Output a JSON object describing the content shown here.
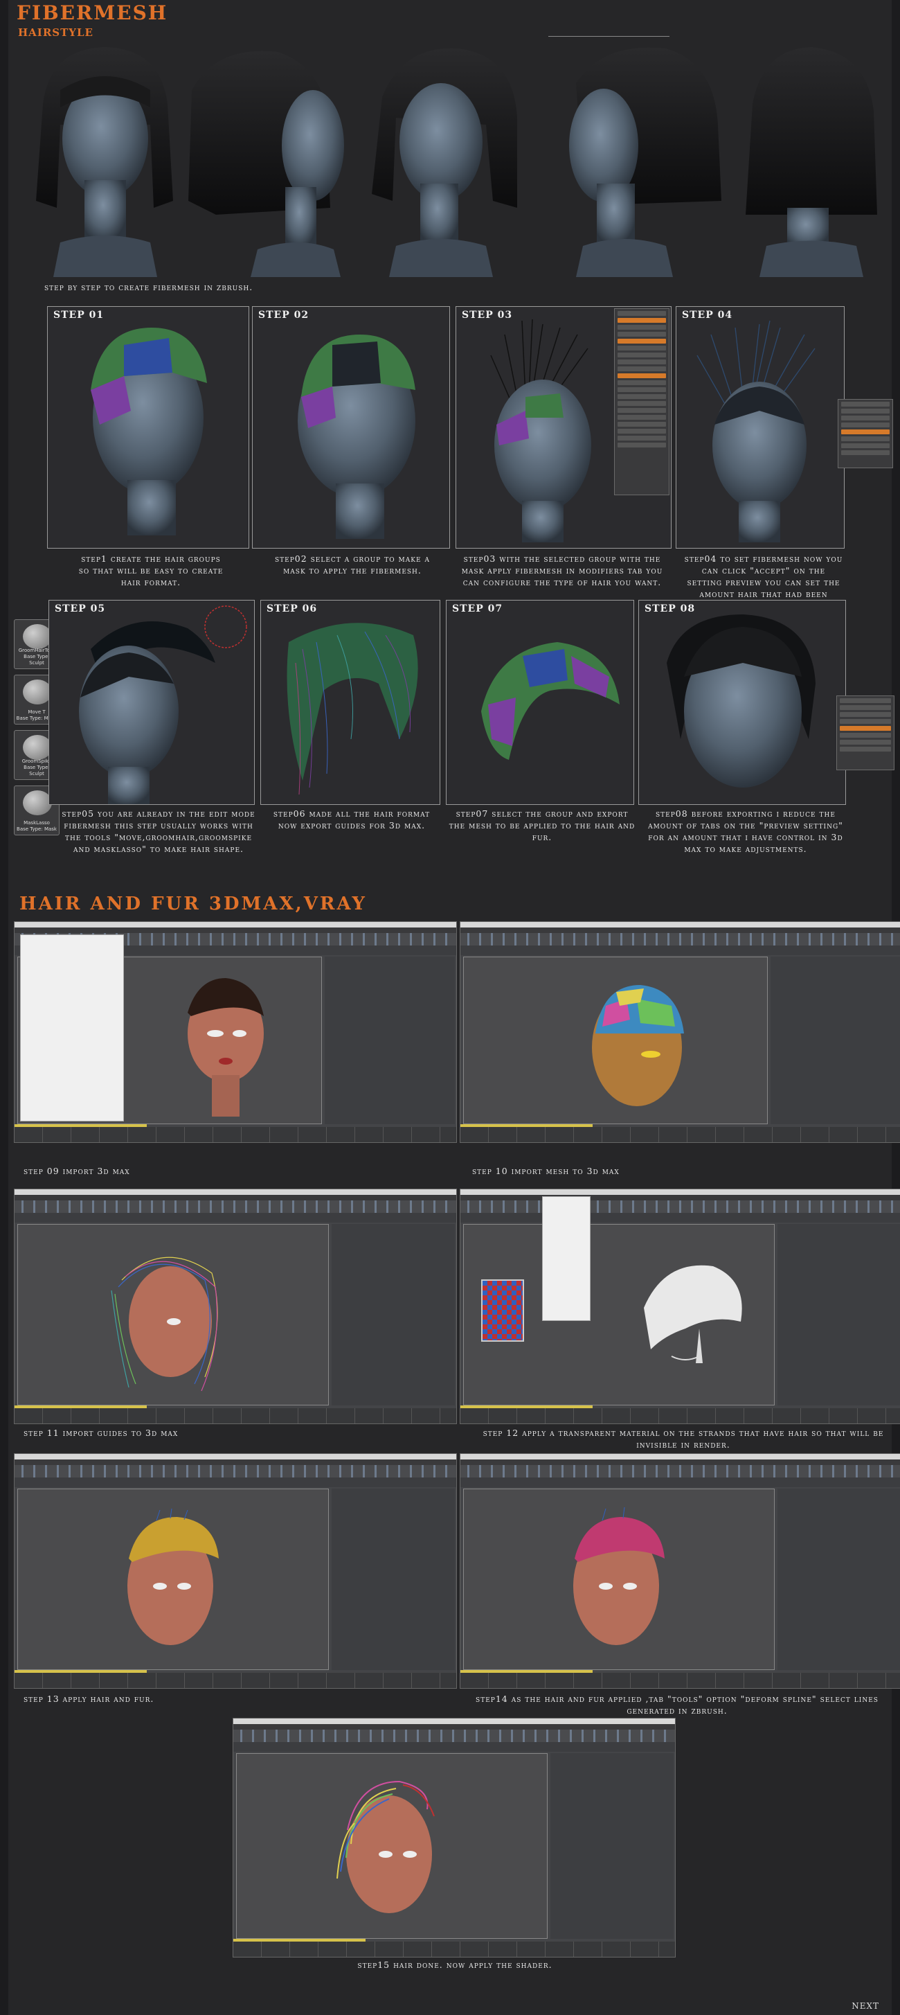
{
  "header": {
    "title": "FIBERMESH",
    "subtitle": "HAIRSTYLE"
  },
  "intro_caption": "step by step to create fibermesh in zbrush.",
  "zbrush_steps": [
    {
      "label": "STEP 01",
      "caption": "step1 create the hair groups so that will be easy to create hair format."
    },
    {
      "label": "STEP 02",
      "caption": "step02 select a group to make a mask to apply the fibermesh."
    },
    {
      "label": "STEP 03",
      "caption": "step03 with the selected group with the mask apply fibermesh in modifiers tab you can configure the type of hair you want."
    },
    {
      "label": "STEP 04",
      "caption": "step04 to set fibermesh now you can click \"accept\" on the setting preview you can set the amount hair that had been visible."
    },
    {
      "label": "STEP 05",
      "caption": "step05 you are already in the edit mode fibermesh this step usually works with the tools \"move,groomhair,groomspike and masklasso\" to make hair shape."
    },
    {
      "label": "STEP 06",
      "caption": "step06 made all the hair format now export guides for 3d max."
    },
    {
      "label": "STEP 07",
      "caption": "step07 select the group and export the mesh to be applied to the hair and fur."
    },
    {
      "label": "STEP 08",
      "caption": "step08 before exporting i reduce the amount of tabs on the \"preview setting\" for an amount that i have control in 3d max to make adjustments."
    }
  ],
  "brushes": [
    {
      "name": "GroomHairToss",
      "type": "Base Type: Sculpt",
      "icon": "groom-hair-toss-brush-icon"
    },
    {
      "name": "Move T",
      "type": "Base Type: Move",
      "icon": "move-brush-icon"
    },
    {
      "name": "GroomSpike",
      "type": "Base Type: Sculpt",
      "icon": "groom-spike-brush-icon"
    },
    {
      "name": "MaskLasso",
      "type": "Base Type: Mask",
      "icon": "mask-lasso-brush-icon"
    }
  ],
  "section2": {
    "title": "HAIR AND FUR 3DMAX,VRAY"
  },
  "max_steps": [
    {
      "caption": "step 09 import 3d max"
    },
    {
      "caption": "step 10 import mesh to 3d max"
    },
    {
      "caption": "step 11 import guides to 3d max"
    },
    {
      "caption": "step 12 apply a transparent material on the strands that have hair so that will be invisible in render."
    },
    {
      "caption": "step 13 apply hair and fur."
    },
    {
      "caption": "step14 as the hair and fur applied ,tab \"tools\" option \"deform spline\" select lines generated in zbrush."
    },
    {
      "caption": "step15 hair done. now apply the shader."
    }
  ],
  "footer": {
    "next_label": "NEXT"
  },
  "colors": {
    "accent": "#e0722a",
    "background": "#262628",
    "panel_border": "#9a9a9a"
  }
}
